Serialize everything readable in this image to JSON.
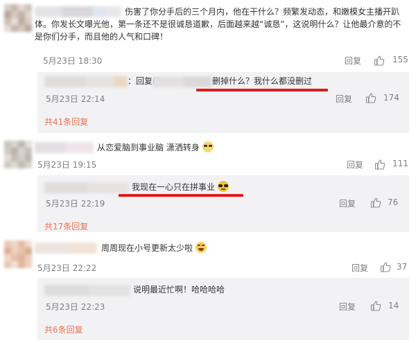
{
  "comments": [
    {
      "text": "伤害了你分手后的三个月内，他在干什么？频繁发动态，和嫩模女主播开趴体。你发长文曝光他，第一条还不是很诚恳道歉，后面越来越“诚恳”，这说明什么？让他最介意的不是你们分手，而且他的人气和口碑！",
      "time": "5月23日 18:30",
      "reply_label": "回复",
      "likes": "155"
    },
    {
      "text": "从恋爱脑到事业脑 潇洒转身",
      "time": "5月23日 19:15",
      "reply_label": "回复",
      "likes": "111"
    },
    {
      "text": "周周现在小号更新太少啦",
      "time": "5月23日 22:22",
      "reply_label": "回复",
      "likes": "37"
    }
  ],
  "replies": [
    {
      "prefix": "：回复@",
      "text": "删掉什么？我什么都没删过",
      "time": "5月23日 22:14",
      "reply_label": "回复",
      "likes": "174",
      "total": "共41条回复"
    },
    {
      "text": "我现在一心只在拼事业",
      "time": "5月23日 22:19",
      "reply_label": "回复",
      "likes": "76",
      "total": "共17条回复"
    },
    {
      "text": "说明最近忙啊！哈哈哈哈",
      "time": "5月23日 22:23",
      "reply_label": "回复",
      "likes": "14",
      "total": "共6条回复"
    }
  ],
  "colors": {
    "accent": "#eb7350",
    "reply_bg": "#f2f2f5",
    "underline": "#e01b1b",
    "meta": "#808080"
  }
}
